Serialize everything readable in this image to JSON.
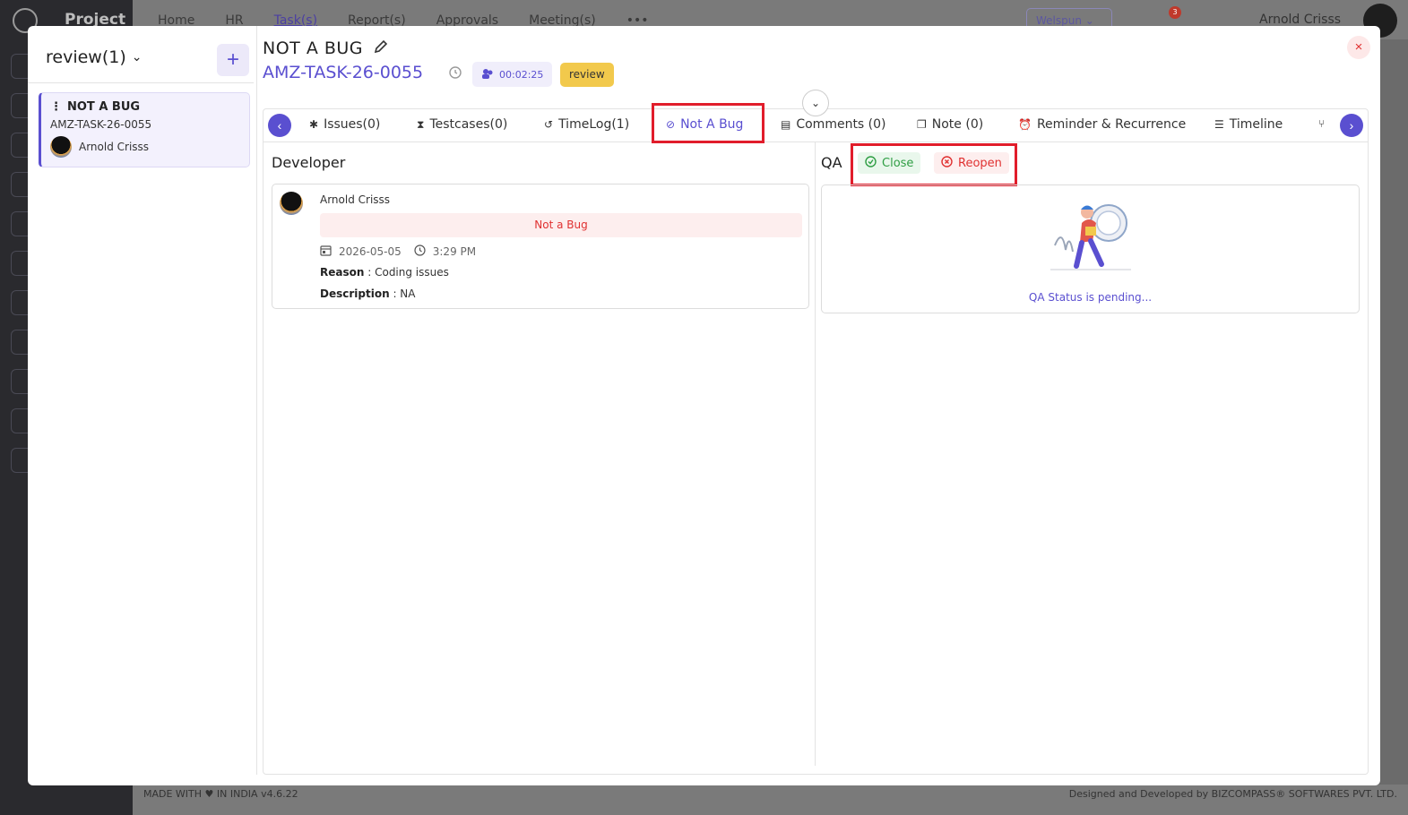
{
  "background": {
    "app_name": "Project",
    "nav": [
      "Home",
      "HR",
      "Task(s)",
      "Report(s)",
      "Approvals",
      "Meeting(s)",
      "•••"
    ],
    "company": "Welspun",
    "notification_count": "3",
    "user_name": "Arnold Crisss",
    "footer_made": "MADE WITH ♥ IN INDIA v4.6.22",
    "footer_designed": "Designed and Developed by BIZCOMPASS® SOFTWARES PVT. LTD."
  },
  "left_panel": {
    "filter_label": "review(1)",
    "add_label": "+",
    "task_card": {
      "title": "NOT A BUG",
      "task_id": "AMZ-TASK-26-0055",
      "assignee": "Arnold Crisss"
    }
  },
  "header": {
    "title": "NOT A BUG",
    "task_id": "AMZ-TASK-26-0055",
    "timer": "00:02:25",
    "status": "review",
    "close_label": "×",
    "collapse_label": "⌄"
  },
  "tabs": [
    {
      "label": "Issues(0)",
      "icon": "bug-icon"
    },
    {
      "label": "Testcases(0)",
      "icon": "hourglass-icon"
    },
    {
      "label": "TimeLog(1)",
      "icon": "history-icon"
    },
    {
      "label": "Not A Bug",
      "icon": "ban-icon"
    },
    {
      "label": "Comments (0)",
      "icon": "comment-icon"
    },
    {
      "label": "Note (0)",
      "icon": "note-icon"
    },
    {
      "label": "Reminder & Recurrence",
      "icon": "alarm-icon"
    },
    {
      "label": "Timeline",
      "icon": "timeline-icon"
    }
  ],
  "active_tab": "Not A Bug",
  "developer": {
    "section_title": "Developer",
    "name": "Arnold Crisss",
    "verdict": "Not a Bug",
    "date": "2026-05-05",
    "time": "3:29 PM",
    "reason_label": "Reason",
    "reason_value": ": Coding issues",
    "description_label": "Description",
    "description_value": ": NA"
  },
  "qa": {
    "section_title": "QA",
    "close_label": "Close",
    "reopen_label": "Reopen",
    "pending_text": "QA Status is pending..."
  },
  "colors": {
    "accent": "#5a4fd0",
    "highlight": "#e11d2b",
    "status_review": "#f2c94c",
    "success": "#2f9e44",
    "danger": "#e03131"
  }
}
